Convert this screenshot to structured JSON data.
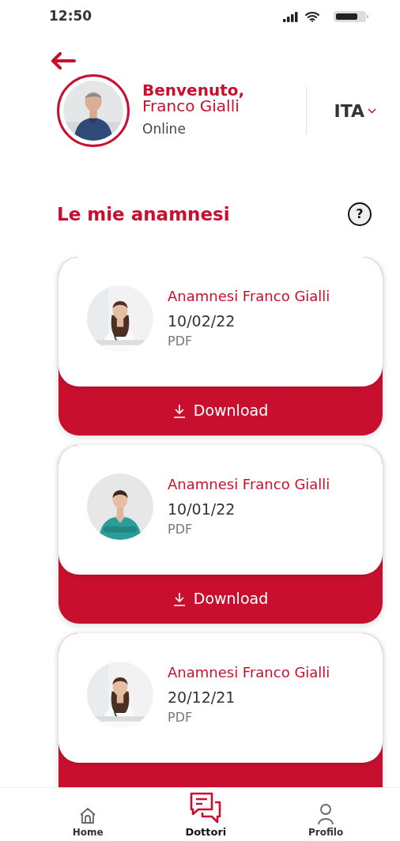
{
  "status_bar": {
    "time": "12:50"
  },
  "profile": {
    "greeting": "Benvenuto,",
    "name": "Franco Gialli",
    "status": "Online",
    "language": "ITA"
  },
  "section": {
    "title": "Le mie anamnesi",
    "help": "?"
  },
  "documents": [
    {
      "title": "Anamnesi Franco Gialli",
      "date": "10/02/22",
      "format": "PDF",
      "download": "Download"
    },
    {
      "title": "Anamnesi Franco Gialli",
      "date": "10/01/22",
      "format": "PDF",
      "download": "Download"
    },
    {
      "title": "Anamnesi Franco Gialli",
      "date": "20/12/21",
      "format": "PDF"
    }
  ],
  "nav": [
    {
      "label": "Home",
      "selected": false
    },
    {
      "label": "Dottori",
      "selected": true
    },
    {
      "label": "Profilo",
      "selected": false
    }
  ]
}
